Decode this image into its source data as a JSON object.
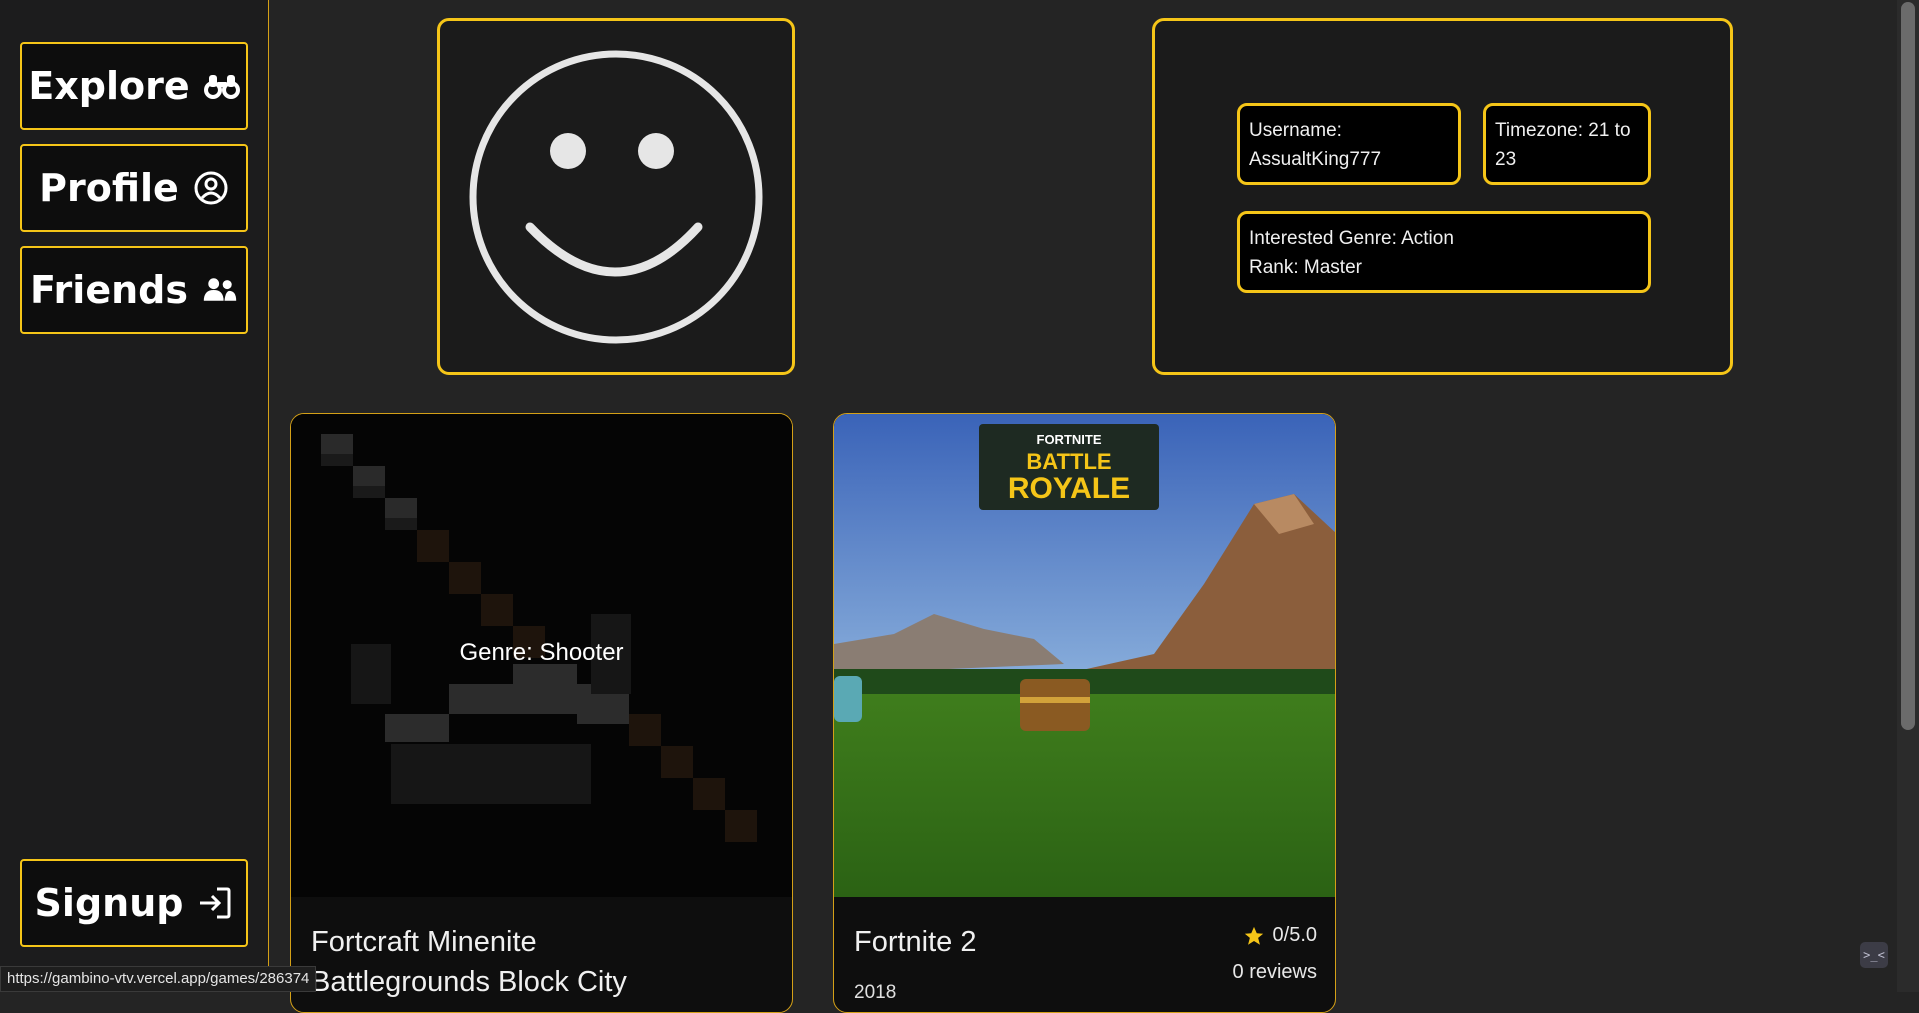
{
  "sidebar": {
    "explore_label": "Explore",
    "profile_label": "Profile",
    "friends_label": "Friends",
    "signup_label": "Signup",
    "icons": [
      "binoculars-icon",
      "user-circle-icon",
      "users-icon",
      "sign-in-icon"
    ]
  },
  "profile": {
    "avatar_icon": "smiley-face-icon",
    "username_line1": "Username:",
    "username_line2": "AssualtKing777",
    "timezone_line1": "Timezone: 21 to",
    "timezone_line2": "23",
    "genre_line": "Interested Genre: Action",
    "rank_line": "Rank: Master"
  },
  "games": [
    {
      "title_line1": "Fortcraft Minenite",
      "title_line2": "Battlegrounds Block City",
      "hover_genre": "Genre: Shooter"
    },
    {
      "title": "Fortnite 2",
      "year": "2018",
      "rating": "0/5.0",
      "reviews": "0 reviews",
      "banner_top": "FORTNITE",
      "banner_line1": "BATTLE",
      "banner_line2": "ROYALE"
    }
  ],
  "status_url": "https://gambino-vtv.vercel.app/games/286374",
  "colors": {
    "accent": "#f5c518",
    "background": "#242424",
    "sidebar": "#1c1c1d"
  }
}
